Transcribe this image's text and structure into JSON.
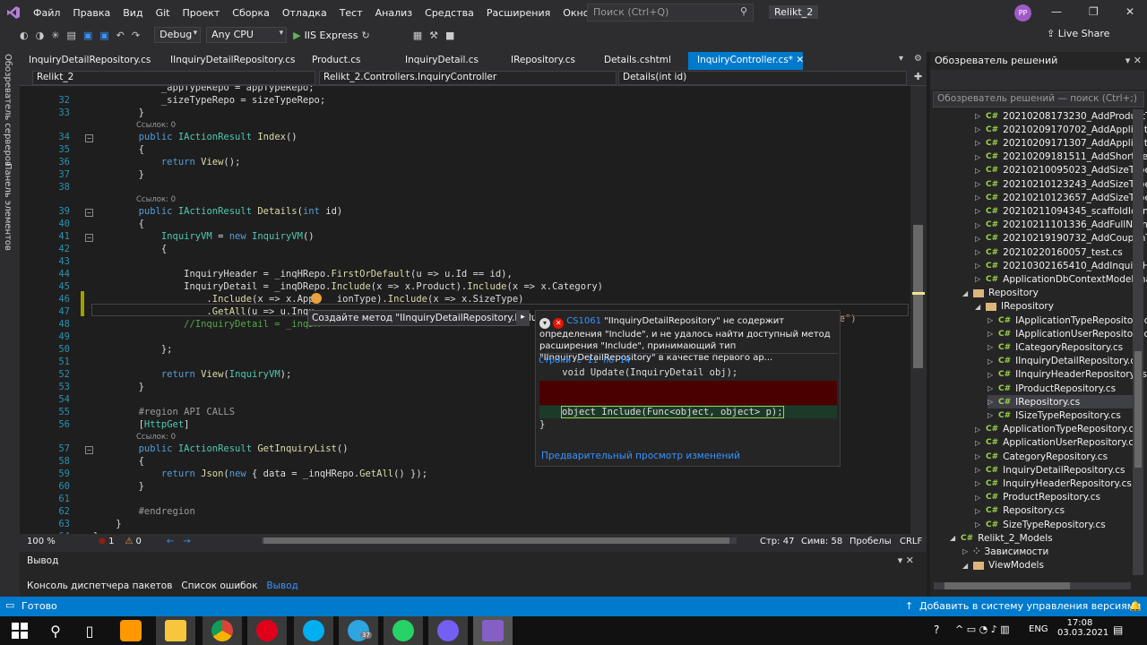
{
  "menu": [
    "Файл",
    "Правка",
    "Вид",
    "Git",
    "Проект",
    "Сборка",
    "Отладка",
    "Тест",
    "Анализ",
    "Средства",
    "Расширения",
    "Окно",
    "Справка"
  ],
  "search": {
    "placeholder": "Поиск (Ctrl+Q)"
  },
  "solution_title": "Relikt_2",
  "avatar": "PP",
  "toolbar": {
    "config": "Debug",
    "platform": "Any CPU",
    "run": "IIS Express",
    "live_share": "Live Share"
  },
  "left_strip": [
    "Обозреватель серверов",
    "Панель элементов"
  ],
  "tabs": [
    {
      "label": "InquiryDetailRepository.cs"
    },
    {
      "label": "IInquiryDetailRepository.cs"
    },
    {
      "label": "Product.cs"
    },
    {
      "label": "InquiryDetail.cs"
    },
    {
      "label": "IRepository.cs"
    },
    {
      "label": "Details.cshtml"
    },
    {
      "label": "InquiryController.cs*"
    }
  ],
  "navbar": {
    "project": "Relikt_2",
    "class": "Relikt_2.Controllers.InquiryController",
    "method": "Details(int id)"
  },
  "code": [
    {
      "n": "",
      "t": "            _appTypeRepo = appTypeRepo;"
    },
    {
      "n": "32",
      "t": "            _sizeTypeRepo = sizeTypeRepo;"
    },
    {
      "n": "33",
      "t": "        }"
    },
    {
      "n": "",
      "r": "Ссылок: 0"
    },
    {
      "n": "34",
      "t": "        public IActionResult Index()"
    },
    {
      "n": "35",
      "t": "        {"
    },
    {
      "n": "36",
      "t": "            return View();"
    },
    {
      "n": "37",
      "t": "        }"
    },
    {
      "n": "38",
      "t": ""
    },
    {
      "n": "",
      "r": "Ссылок: 0"
    },
    {
      "n": "39",
      "t": "        public IActionResult Details(int id)"
    },
    {
      "n": "40",
      "t": "        {"
    },
    {
      "n": "41",
      "t": "            InquiryVM = new InquiryVM()"
    },
    {
      "n": "42",
      "t": "            {"
    },
    {
      "n": "43",
      "t": ""
    },
    {
      "n": "44",
      "t": "                InquiryHeader = _inqHRepo.FirstOrDefault(u => u.Id == id),"
    },
    {
      "n": "45",
      "t": "                InquiryDetail = _inqDRepo.Include(x => x.Product).Include(x => x.Category)"
    },
    {
      "n": "46",
      "t": "                    .Include(x => x.Appl   ionType).Include(x => x.SizeType)"
    },
    {
      "n": "47",
      "t": "                    .GetAll(u => u.Inqu"
    },
    {
      "n": "48",
      "t": "                //InquiryDetail = _inqDR"
    },
    {
      "n": "49",
      "t": ""
    },
    {
      "n": "50",
      "t": "            };"
    },
    {
      "n": "51",
      "t": ""
    },
    {
      "n": "52",
      "t": "            return View(InquiryVM);"
    },
    {
      "n": "53",
      "t": "        }"
    },
    {
      "n": "54",
      "t": ""
    },
    {
      "n": "55",
      "t": "        #region API CALLS"
    },
    {
      "n": "56",
      "t": "        [HttpGet]"
    },
    {
      "n": "",
      "r": "Ссылок: 0"
    },
    {
      "n": "57",
      "t": "        public IActionResult GetInquiryList()"
    },
    {
      "n": "58",
      "t": "        {"
    },
    {
      "n": "59",
      "t": "            return Json(new { data = _inqHRepo.GetAll() });"
    },
    {
      "n": "60",
      "t": "        }"
    },
    {
      "n": "61",
      "t": ""
    },
    {
      "n": "62",
      "t": "        #endregion"
    },
    {
      "n": "63",
      "t": "    }"
    },
    {
      "n": "64",
      "t": "}"
    }
  ],
  "code_tail": "ype\")",
  "tip": "Создайте метод \"IInquiryDetailRepository.Include\"",
  "popup": {
    "code": "CS1061",
    "message": " \"IInquiryDetailRepository\" не содержит определения \"Include\", и не удалось найти доступный метод расширения \"Include\", принимающий тип \"IInquiryDetailRepository\" в качестве первого ар...",
    "range": "Строки с 11 по 14",
    "line1": "    void Update(InquiryDetail obj);",
    "line2": "object Include(Func<object, object> p);",
    "line3": "}",
    "footer": "Предварительный просмотр изменений"
  },
  "hbar": {
    "zoom": "100 %",
    "errors": "1",
    "warnings": "0",
    "line": "Стр: 47",
    "col": "Симв: 58",
    "ws": "Пробелы",
    "eol": "CRLF"
  },
  "output": {
    "title": "Вывод",
    "tabs": [
      "Консоль диспетчера пакетов",
      "Список ошибок",
      "Вывод"
    ]
  },
  "solution": {
    "title": "Обозреватель решений",
    "search": "Обозреватель решений — поиск (Ctrl+;)",
    "items": [
      {
        "label": "20210208173230_AddProductToD",
        "type": "cs",
        "lvl": 3
      },
      {
        "label": "20210209170702_AddApplication",
        "type": "cs",
        "lvl": 3
      },
      {
        "label": "20210209171307_AddApplication",
        "type": "cs",
        "lvl": 3
      },
      {
        "label": "20210209181511_AddShortDescT",
        "type": "cs",
        "lvl": 3
      },
      {
        "label": "20210210095023_AddSizeTypeTo",
        "type": "cs",
        "lvl": 3
      },
      {
        "label": "20210210123243_AddSizeTypeTo",
        "type": "cs",
        "lvl": 3
      },
      {
        "label": "20210210123657_AddSizeTypeTo",
        "type": "cs",
        "lvl": 3
      },
      {
        "label": "20210211094345_scaffoldIdentity",
        "type": "cs",
        "lvl": 3
      },
      {
        "label": "20210211101336_AddFullNameTo",
        "type": "cs",
        "lvl": 3
      },
      {
        "label": "20210219190732_AddCouponToD",
        "type": "cs",
        "lvl": 3
      },
      {
        "label": "20210220160057_test.cs",
        "type": "cs",
        "lvl": 3
      },
      {
        "label": "20210302165410_AddInquiryHea",
        "type": "cs",
        "lvl": 3
      },
      {
        "label": "ApplicationDbContextModelSnap",
        "type": "cs",
        "lvl": 3
      },
      {
        "label": "Repository",
        "type": "folder",
        "lvl": 2,
        "open": true
      },
      {
        "label": "IRepository",
        "type": "folder",
        "lvl": 3,
        "open": true
      },
      {
        "label": "IApplicationTypeRepository.cs",
        "type": "cs",
        "lvl": 4
      },
      {
        "label": "IApplicationUserRepository.cs",
        "type": "cs",
        "lvl": 4
      },
      {
        "label": "ICategoryRepository.cs",
        "type": "cs",
        "lvl": 4
      },
      {
        "label": "IInquiryDetailRepository.cs",
        "type": "cs",
        "lvl": 4
      },
      {
        "label": "IInquiryHeaderRepository.cs",
        "type": "cs",
        "lvl": 4
      },
      {
        "label": "IProductRepository.cs",
        "type": "cs",
        "lvl": 4
      },
      {
        "label": "IRepository.cs",
        "type": "cs",
        "lvl": 4,
        "sel": true
      },
      {
        "label": "ISizeTypeRepository.cs",
        "type": "cs",
        "lvl": 4
      },
      {
        "label": "ApplicationTypeRepository.cs",
        "type": "cs",
        "lvl": 3
      },
      {
        "label": "ApplicationUserRepository.cs",
        "type": "cs",
        "lvl": 3
      },
      {
        "label": "CategoryRepository.cs",
        "type": "cs",
        "lvl": 3
      },
      {
        "label": "InquiryDetailRepository.cs",
        "type": "cs",
        "lvl": 3
      },
      {
        "label": "InquiryHeaderRepository.cs",
        "type": "cs",
        "lvl": 3
      },
      {
        "label": "ProductRepository.cs",
        "type": "cs",
        "lvl": 3
      },
      {
        "label": "Repository.cs",
        "type": "cs",
        "lvl": 3
      },
      {
        "label": "SizeTypeRepository.cs",
        "type": "cs",
        "lvl": 3
      },
      {
        "label": "Relikt_2_Models",
        "type": "proj",
        "lvl": 1,
        "open": true
      },
      {
        "label": "Зависимости",
        "type": "dep",
        "lvl": 2
      },
      {
        "label": "ViewModels",
        "type": "folder",
        "lvl": 2,
        "open": true
      }
    ]
  },
  "status": {
    "ready": "Готово",
    "vcs": "Добавить в систему управления версиями"
  },
  "taskbar": {
    "time": "17:08",
    "date": "03.03.2021",
    "lang": "ENG",
    "badge": "37"
  },
  "colors": {
    "accent": "#007acc",
    "bg": "#1e1e1e",
    "chrome": "#2d2d30"
  }
}
